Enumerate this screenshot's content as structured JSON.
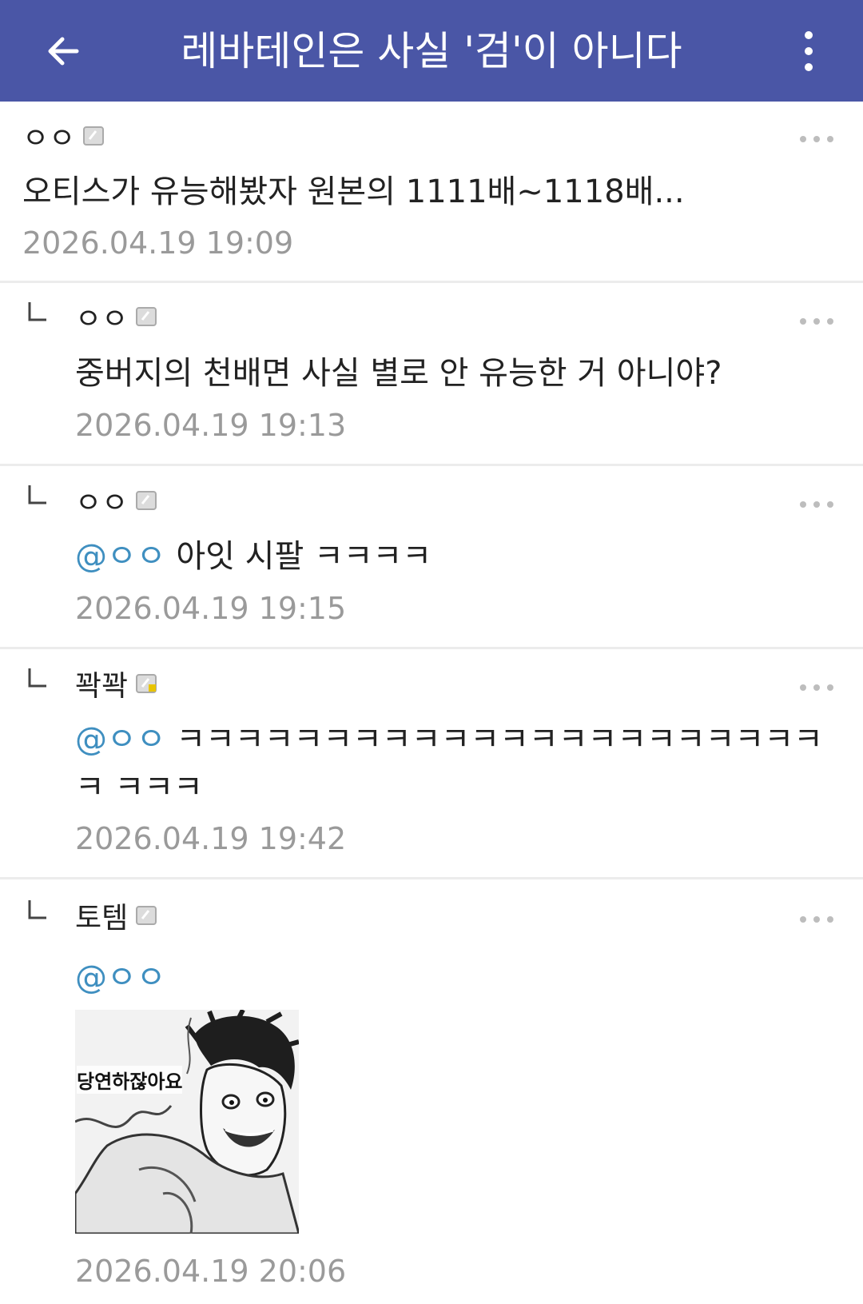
{
  "header": {
    "title": "레바테인은 사실 '검'이 아니다"
  },
  "comments": [
    {
      "author": "ㅇㅇ",
      "mention": "",
      "text": "오티스가 유능해봤자 원본의 1111배~1118배...",
      "time": "2026.04.19 19:09"
    },
    {
      "author": "ㅇㅇ",
      "mention": "",
      "text": "중버지의 천배면 사실 별로 안 유능한 거 아니야?",
      "time": "2026.04.19 19:13"
    },
    {
      "author": "ㅇㅇ",
      "mention": "@ㅇㅇ",
      "text": " 아잇 시팔 ㅋㅋㅋㅋ",
      "time": "2026.04.19 19:15"
    },
    {
      "author": "꽉꽉",
      "mention": "@ㅇㅇ",
      "text": " ㅋㅋㅋㅋㅋㅋㅋㅋㅋㅋㅋㅋㅋㅋㅋㅋㅋㅋㅋㅋㅋㅋㅋ ㅋㅋㅋ",
      "time": "2026.04.19 19:42"
    },
    {
      "author": "토템",
      "mention": "@ㅇㅇ",
      "text": "",
      "image_caption": "당연하잖아요",
      "time": "2026.04.19 20:06"
    }
  ],
  "icons": {
    "back": "arrow-left-icon",
    "menu": "more-vertical-icon",
    "more": "more-horizontal-icon",
    "badge": "gallery-badge-icon",
    "reply": "reply-arrow-icon"
  },
  "colors": {
    "appbar": "#4a56a6",
    "mention": "#3f8fc0",
    "timestamp": "#9a9a9a",
    "divider": "#ececec"
  }
}
